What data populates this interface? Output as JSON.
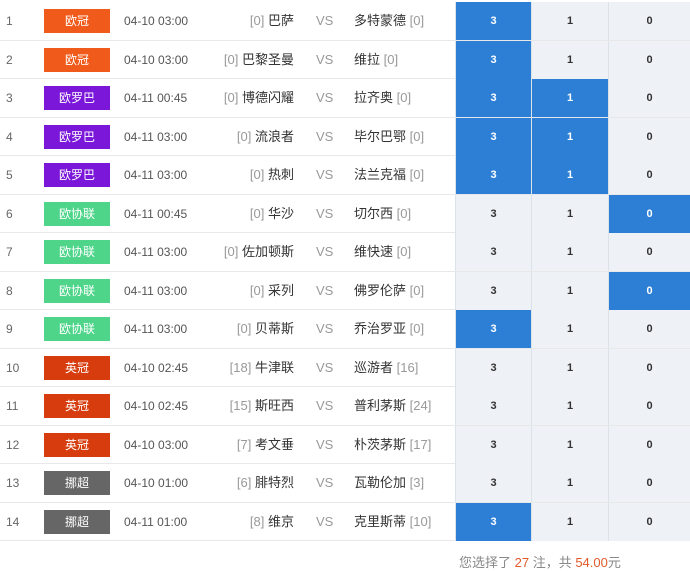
{
  "colors": {
    "ouguan": "#f05a1a",
    "ouluoba": "#7a17d9",
    "ouxielian": "#4ed58a",
    "yingguan": "#d63c0e",
    "nuochao": "#666666",
    "selected": "#2d7fd5",
    "unselected": "#eef2f7"
  },
  "rows": [
    {
      "idx": "1",
      "league": "欧冠",
      "color": "#f05a1a",
      "date": "04-10 03:00",
      "home_rank": "[0]",
      "home": "巴萨",
      "vs": "VS",
      "away": "多特蒙德",
      "away_rank": "[0]",
      "o3": "3",
      "o1": "1",
      "o0": "0",
      "sel": [
        true,
        false,
        false
      ]
    },
    {
      "idx": "2",
      "league": "欧冠",
      "color": "#f05a1a",
      "date": "04-10 03:00",
      "home_rank": "[0]",
      "home": "巴黎圣曼",
      "vs": "VS",
      "away": "维拉",
      "away_rank": "[0]",
      "o3": "3",
      "o1": "1",
      "o0": "0",
      "sel": [
        true,
        false,
        false
      ]
    },
    {
      "idx": "3",
      "league": "欧罗巴",
      "color": "#7a17d9",
      "date": "04-11 00:45",
      "home_rank": "[0]",
      "home": "博德闪耀",
      "vs": "VS",
      "away": "拉齐奥",
      "away_rank": "[0]",
      "o3": "3",
      "o1": "1",
      "o0": "0",
      "sel": [
        true,
        true,
        false
      ]
    },
    {
      "idx": "4",
      "league": "欧罗巴",
      "color": "#7a17d9",
      "date": "04-11 03:00",
      "home_rank": "[0]",
      "home": "流浪者",
      "vs": "VS",
      "away": "毕尔巴鄂",
      "away_rank": "[0]",
      "o3": "3",
      "o1": "1",
      "o0": "0",
      "sel": [
        true,
        true,
        false
      ]
    },
    {
      "idx": "5",
      "league": "欧罗巴",
      "color": "#7a17d9",
      "date": "04-11 03:00",
      "home_rank": "[0]",
      "home": "热刺",
      "vs": "VS",
      "away": "法兰克福",
      "away_rank": "[0]",
      "o3": "3",
      "o1": "1",
      "o0": "0",
      "sel": [
        true,
        true,
        false
      ]
    },
    {
      "idx": "6",
      "league": "欧协联",
      "color": "#4ed58a",
      "date": "04-11 00:45",
      "home_rank": "[0]",
      "home": "华沙",
      "vs": "VS",
      "away": "切尔西",
      "away_rank": "[0]",
      "o3": "3",
      "o1": "1",
      "o0": "0",
      "sel": [
        false,
        false,
        true
      ]
    },
    {
      "idx": "7",
      "league": "欧协联",
      "color": "#4ed58a",
      "date": "04-11 03:00",
      "home_rank": "[0]",
      "home": "佐加顿斯",
      "vs": "VS",
      "away": "维快速",
      "away_rank": "[0]",
      "o3": "3",
      "o1": "1",
      "o0": "0",
      "sel": [
        false,
        false,
        false
      ]
    },
    {
      "idx": "8",
      "league": "欧协联",
      "color": "#4ed58a",
      "date": "04-11 03:00",
      "home_rank": "[0]",
      "home": "采列",
      "vs": "VS",
      "away": "佛罗伦萨",
      "away_rank": "[0]",
      "o3": "3",
      "o1": "1",
      "o0": "0",
      "sel": [
        false,
        false,
        true
      ]
    },
    {
      "idx": "9",
      "league": "欧协联",
      "color": "#4ed58a",
      "date": "04-11 03:00",
      "home_rank": "[0]",
      "home": "贝蒂斯",
      "vs": "VS",
      "away": "乔治罗亚",
      "away_rank": "[0]",
      "o3": "3",
      "o1": "1",
      "o0": "0",
      "sel": [
        true,
        false,
        false
      ]
    },
    {
      "idx": "10",
      "league": "英冠",
      "color": "#d63c0e",
      "date": "04-10 02:45",
      "home_rank": "[18]",
      "home": "牛津联",
      "vs": "VS",
      "away": "巡游者",
      "away_rank": "[16]",
      "o3": "3",
      "o1": "1",
      "o0": "0",
      "sel": [
        false,
        false,
        false
      ]
    },
    {
      "idx": "11",
      "league": "英冠",
      "color": "#d63c0e",
      "date": "04-10 02:45",
      "home_rank": "[15]",
      "home": "斯旺西",
      "vs": "VS",
      "away": "普利茅斯",
      "away_rank": "[24]",
      "o3": "3",
      "o1": "1",
      "o0": "0",
      "sel": [
        false,
        false,
        false
      ]
    },
    {
      "idx": "12",
      "league": "英冠",
      "color": "#d63c0e",
      "date": "04-10 03:00",
      "home_rank": "[7]",
      "home": "考文垂",
      "vs": "VS",
      "away": "朴茨茅斯",
      "away_rank": "[17]",
      "o3": "3",
      "o1": "1",
      "o0": "0",
      "sel": [
        false,
        false,
        false
      ]
    },
    {
      "idx": "13",
      "league": "挪超",
      "color": "#666666",
      "date": "04-10 01:00",
      "home_rank": "[6]",
      "home": "腓特烈",
      "vs": "VS",
      "away": "瓦勒伦加",
      "away_rank": "[3]",
      "o3": "3",
      "o1": "1",
      "o0": "0",
      "sel": [
        false,
        false,
        false
      ]
    },
    {
      "idx": "14",
      "league": "挪超",
      "color": "#666666",
      "date": "04-11 01:00",
      "home_rank": "[8]",
      "home": "维京",
      "vs": "VS",
      "away": "克里斯蒂",
      "away_rank": "[10]",
      "o3": "3",
      "o1": "1",
      "o0": "0",
      "sel": [
        true,
        false,
        false
      ]
    }
  ],
  "summary": {
    "prefix": "您选择了 ",
    "count": "27",
    "middle": " 注，共 ",
    "amount": "54.00",
    "suffix": "元"
  }
}
